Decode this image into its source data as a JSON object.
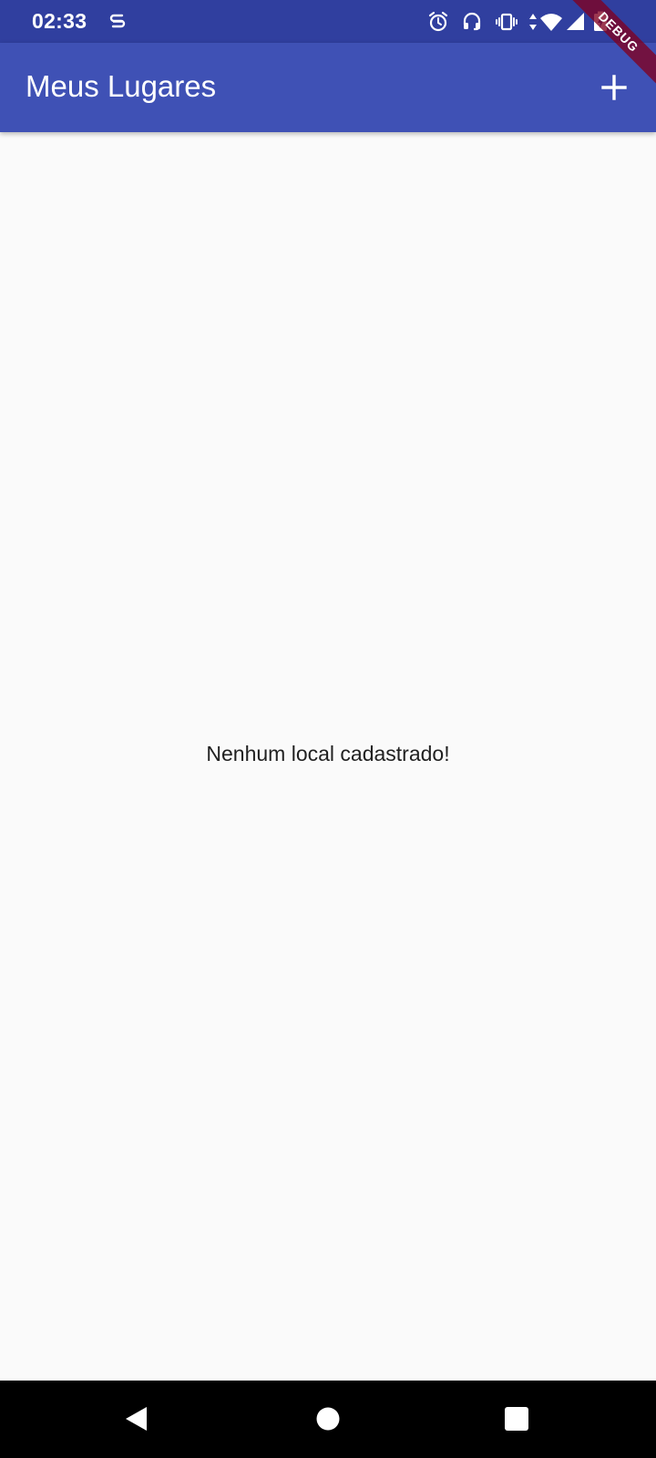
{
  "status_bar": {
    "time": "02:33",
    "icons": [
      "s-notification-icon",
      "alarm-icon",
      "headset-icon",
      "vibrate-icon",
      "data-arrows-icon",
      "wifi-icon",
      "signal-icon",
      "battery-charging-icon"
    ]
  },
  "debug_banner": "DEBUG",
  "app_bar": {
    "title": "Meus Lugares",
    "action_icon": "add-icon"
  },
  "main": {
    "empty_message": "Nenhum local cadastrado!"
  },
  "nav_bar": {
    "buttons": [
      "back-icon",
      "home-icon",
      "recents-icon"
    ]
  },
  "colors": {
    "status_bar": "#303f9f",
    "app_bar": "#3f51b5",
    "background": "#fafafa",
    "debug_ribbon": "#800020"
  }
}
